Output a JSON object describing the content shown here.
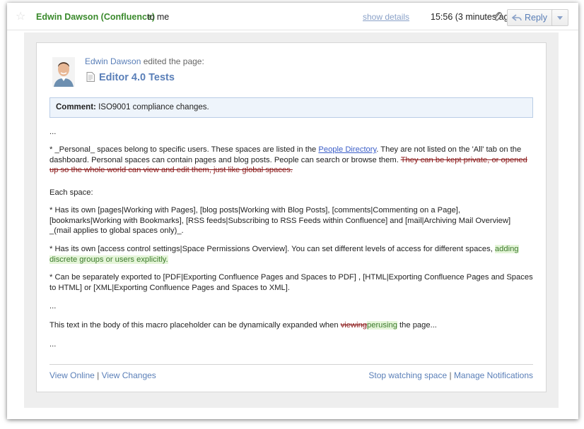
{
  "header": {
    "sender": "Edwin Dawson (Confluence)",
    "to_me": "to me",
    "show_details": "show details",
    "time": "15:56 (3 minutes ago)",
    "reply_label": "Reply"
  },
  "notification": {
    "editor_name": "Edwin Dawson",
    "edited_text": "edited the page:",
    "page_title": "Editor 4.0 Tests",
    "comment_label": "Comment:",
    "comment_text": "ISO9001 compliance changes."
  },
  "content": {
    "ellipsis": "...",
    "p1_a": "* _Personal_ spaces belong to specific users. These spaces are listed in the",
    "p1_link": "People Directory",
    "p1_b": ". They are not listed on the 'All' tab on the dashboard. Personal spaces can contain pages and blog posts. People can search or browse them.",
    "p1_del": "They can be kept private, or opened up so the whole world can view and edit them, just like global spaces.",
    "p2": "Each space:",
    "p3": "* Has its own [pages|Working with Pages], [blog posts|Working with Blog Posts], [comments|Commenting on a Page], [bookmarks|Working with Bookmarks], [RSS feeds|Subscribing to RSS Feeds within Confluence] and [mail|Archiving Mail Overview] _(mail applies to global spaces only)_.",
    "p4_a": "* Has its own [access control settings|Space Permissions Overview]. You can set different levels of access for different spaces,",
    "p4_ins": "adding discrete groups or users explicitly.",
    "p5": "* Can be separately exported to [PDF|Exporting Confluence Pages and Spaces to PDF] , [HTML|Exporting Confluence Pages and Spaces to HTML] or [XML|Exporting Confluence Pages and Spaces to XML].",
    "p6_a": "This text in the body of this macro placeholder can be dynamically expanded when",
    "p6_del": "viewing",
    "p6_ins": "perusing",
    "p6_b": "the page..."
  },
  "footer": {
    "view_online": "View Online",
    "view_changes": "View Changes",
    "separator": "|",
    "stop_watching": "Stop watching space",
    "manage_notifications": "Manage Notifications"
  },
  "colors": {
    "sender": "#3a8a2c",
    "link": "#5a7fb8",
    "inserted_bg": "#e5f5d9",
    "deleted": "#8b1a1a",
    "comment_bg": "#eef4fb"
  },
  "icons": [
    "star-icon",
    "paperclip-icon",
    "reply-arrow-icon",
    "dropdown-arrow-icon",
    "document-icon"
  ]
}
